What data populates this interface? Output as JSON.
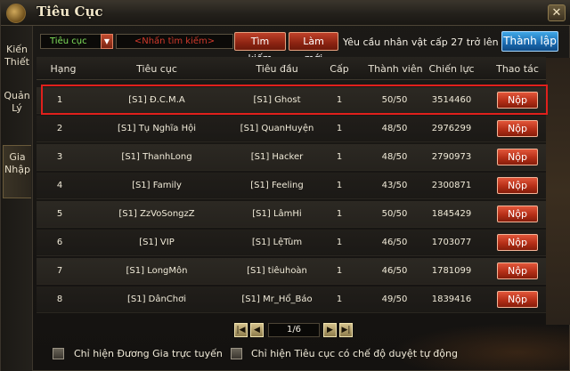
{
  "window": {
    "title": "Tiêu Cục",
    "close_label": "✕"
  },
  "sidebar": {
    "tabs": [
      {
        "label": "Kiến Thiết"
      },
      {
        "label": "Quản Lý"
      },
      {
        "label": "Gia Nhập"
      }
    ]
  },
  "toolbar": {
    "filter_value": "Tiêu cục",
    "filter_arrow": "▼",
    "search_placeholder": "<Nhấn tìm kiếm>",
    "search_label": "Tìm kiếm",
    "refresh_label": "Làm mới",
    "requirement": "Yêu cầu nhân vật cấp 27 trở lên",
    "create_label": "Thành lập"
  },
  "table": {
    "headers": [
      "Hạng",
      "Tiêu cục",
      "Tiêu đầu",
      "Cấp",
      "Thành viên",
      "Chiến lực",
      "Thao tác"
    ],
    "rows": [
      {
        "rank": "1",
        "guild": "[S1] Đ.C.M.A",
        "leader": "[S1] Ghost",
        "level": "1",
        "members": "50/50",
        "power": "3514460",
        "action": "Nộp"
      },
      {
        "rank": "2",
        "guild": "[S1] Tụ Nghĩa Hội",
        "leader": "[S1] QuanHuyện",
        "level": "1",
        "members": "48/50",
        "power": "2976299",
        "action": "Nộp"
      },
      {
        "rank": "3",
        "guild": "[S1] ThanhLong",
        "leader": "[S1] Hacker",
        "level": "1",
        "members": "48/50",
        "power": "2790973",
        "action": "Nộp"
      },
      {
        "rank": "4",
        "guild": "[S1] Family",
        "leader": "[S1] Feeling",
        "level": "1",
        "members": "43/50",
        "power": "2300871",
        "action": "Nộp"
      },
      {
        "rank": "5",
        "guild": "[S1] ZzVoSongzZ",
        "leader": "[S1] LâmHi",
        "level": "1",
        "members": "50/50",
        "power": "1845429",
        "action": "Nộp"
      },
      {
        "rank": "6",
        "guild": "[S1] VIP",
        "leader": "[S1] LệTùm",
        "level": "1",
        "members": "46/50",
        "power": "1703077",
        "action": "Nộp"
      },
      {
        "rank": "7",
        "guild": "[S1] LongMôn",
        "leader": "[S1] tiêuhoàn",
        "level": "1",
        "members": "46/50",
        "power": "1781099",
        "action": "Nộp"
      },
      {
        "rank": "8",
        "guild": "[S1] DânChơi",
        "leader": "[S1] Mr_Hổ_Báo",
        "level": "1",
        "members": "49/50",
        "power": "1839416",
        "action": "Nộp"
      }
    ]
  },
  "pager": {
    "first": "|◀",
    "prev": "◀",
    "display": "1/6",
    "next": "▶",
    "last": "▶|"
  },
  "footer": {
    "online_only": "Chỉ hiện Đương Gia trực tuyến",
    "auto_approve": "Chỉ hiện Tiêu cục có chế độ duyệt tự động"
  }
}
